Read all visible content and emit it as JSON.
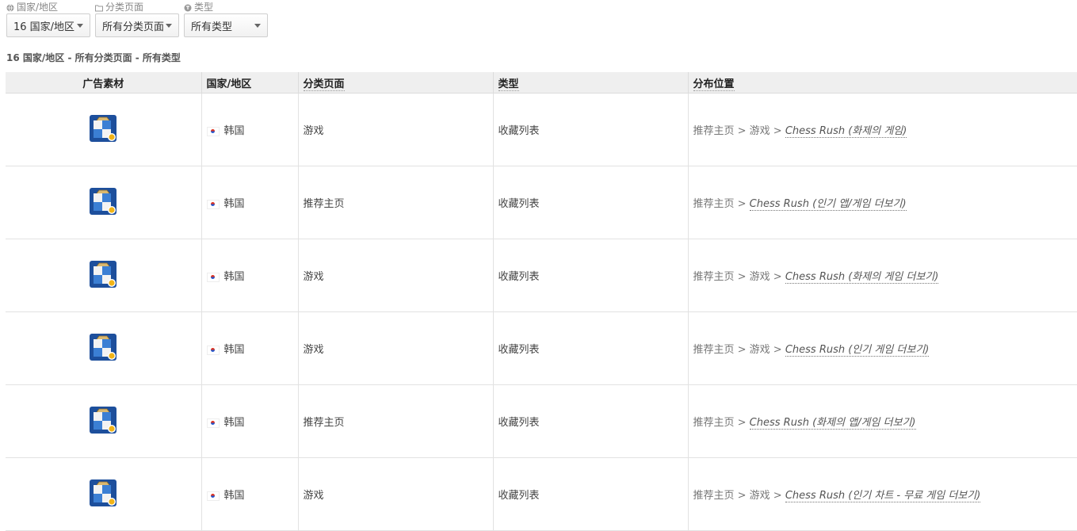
{
  "filters": [
    {
      "label": "国家/地区",
      "icon": "globe-icon",
      "value": "16 国家/地区"
    },
    {
      "label": "分类页面",
      "icon": "folder-icon",
      "value": "所有分类页面"
    },
    {
      "label": "类型",
      "icon": "type-icon",
      "value": "所有类型"
    }
  ],
  "summary": "16 国家/地区 - 所有分类页面 - 所有类型",
  "table": {
    "headers": [
      "广告素材",
      "国家/地区",
      "分类页面",
      "类型",
      "分布位置"
    ],
    "rows": [
      {
        "country": "韩国",
        "category": "游戏",
        "type": "收藏列表",
        "path_prefix": "推荐主页 > 游戏 >",
        "link": "Chess Rush (화제의 게임)"
      },
      {
        "country": "韩国",
        "category": "推荐主页",
        "type": "收藏列表",
        "path_prefix": "推荐主页 >",
        "link": "Chess Rush (인기 앱/게임 더보기)"
      },
      {
        "country": "韩国",
        "category": "游戏",
        "type": "收藏列表",
        "path_prefix": "推荐主页 > 游戏 >",
        "link": "Chess Rush (화제의 게임 더보기)"
      },
      {
        "country": "韩国",
        "category": "游戏",
        "type": "收藏列表",
        "path_prefix": "推荐主页 > 游戏 >",
        "link": "Chess Rush (인기 게임 더보기)"
      },
      {
        "country": "韩国",
        "category": "推荐主页",
        "type": "收藏列表",
        "path_prefix": "推荐主页 >",
        "link": "Chess Rush (화제의 앱/게임 더보기)"
      },
      {
        "country": "韩国",
        "category": "游戏",
        "type": "收藏列表",
        "path_prefix": "推荐主页 > 游戏 >",
        "link": "Chess Rush (인기 차트 - 무료 게임 더보기)"
      }
    ]
  }
}
